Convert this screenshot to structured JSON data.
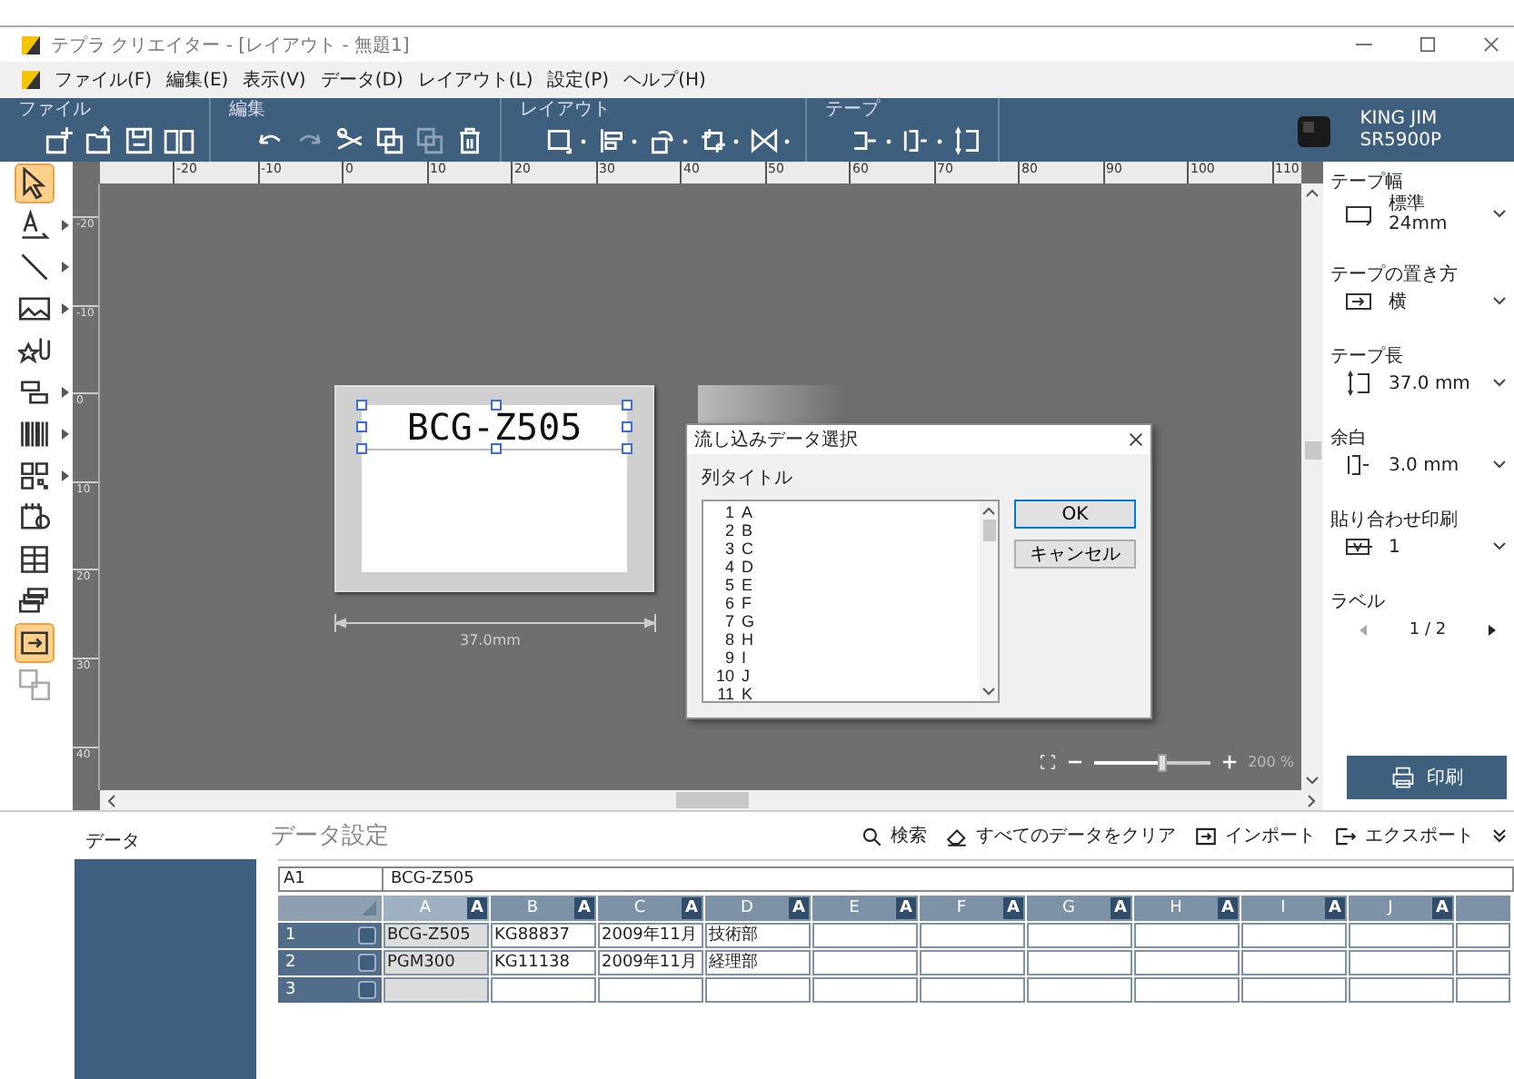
{
  "window": {
    "title": "テプラ クリエイター - [レイアウト - 無題1]"
  },
  "menu": [
    "ファイル(F)",
    "編集(E)",
    "表示(V)",
    "データ(D)",
    "レイアウト(L)",
    "設定(P)",
    "ヘルプ(H)"
  ],
  "ribbon": {
    "groups": [
      {
        "label": "ファイル",
        "tools": [
          {
            "kind": "new",
            "disabled": false,
            "dropdown": false
          },
          {
            "kind": "open",
            "disabled": false,
            "dropdown": false
          },
          {
            "kind": "save",
            "disabled": false,
            "dropdown": false
          },
          {
            "kind": "book",
            "disabled": false,
            "dropdown": false
          }
        ]
      },
      {
        "label": "編集",
        "tools": [
          {
            "kind": "undo",
            "disabled": false,
            "dropdown": false
          },
          {
            "kind": "redo",
            "disabled": true,
            "dropdown": false
          },
          {
            "kind": "cut",
            "disabled": false,
            "dropdown": false
          },
          {
            "kind": "copy",
            "disabled": false,
            "dropdown": false
          },
          {
            "kind": "paste",
            "disabled": true,
            "dropdown": false
          },
          {
            "kind": "trash",
            "disabled": false,
            "dropdown": false
          }
        ]
      },
      {
        "label": "レイアウト",
        "tools": [
          {
            "kind": "frame",
            "disabled": false,
            "dropdown": true
          },
          {
            "kind": "align",
            "disabled": false,
            "dropdown": true
          },
          {
            "kind": "rotate",
            "disabled": false,
            "dropdown": true
          },
          {
            "kind": "group",
            "disabled": false,
            "dropdown": true
          },
          {
            "kind": "bow",
            "disabled": false,
            "dropdown": true
          }
        ]
      },
      {
        "label": "テープ",
        "tools": [
          {
            "kind": "tape",
            "disabled": false,
            "dropdown": true
          },
          {
            "kind": "margin",
            "disabled": false,
            "dropdown": true
          },
          {
            "kind": "length",
            "disabled": false,
            "dropdown": false
          }
        ]
      }
    ],
    "printer": {
      "brand": "KING JIM",
      "model": "SR5900P"
    }
  },
  "tools": [
    {
      "kind": "pointer",
      "selected": true,
      "disabled": false,
      "submenu": false
    },
    {
      "kind": "text",
      "selected": false,
      "disabled": false,
      "submenu": true
    },
    {
      "kind": "line",
      "selected": false,
      "disabled": false,
      "submenu": true
    },
    {
      "kind": "image",
      "selected": false,
      "disabled": false,
      "submenu": true
    },
    {
      "kind": "clip",
      "selected": false,
      "disabled": false,
      "submenu": false
    },
    {
      "kind": "frames",
      "selected": false,
      "disabled": false,
      "submenu": true
    },
    {
      "kind": "barcode",
      "selected": false,
      "disabled": false,
      "submenu": true
    },
    {
      "kind": "qr",
      "selected": false,
      "disabled": false,
      "submenu": true
    },
    {
      "kind": "calendar",
      "selected": false,
      "disabled": false,
      "submenu": false
    },
    {
      "kind": "table",
      "selected": false,
      "disabled": false,
      "submenu": false
    },
    {
      "kind": "stack",
      "selected": false,
      "disabled": false,
      "submenu": false
    },
    {
      "kind": "import",
      "selected": true,
      "disabled": false,
      "submenu": false
    },
    {
      "kind": "translate",
      "selected": false,
      "disabled": true,
      "submenu": false
    }
  ],
  "ruler": {
    "horizontal": [
      "-20",
      "-10",
      "0",
      "10",
      "20",
      "30",
      "40",
      "50",
      "60",
      "70",
      "80",
      "90",
      "100",
      "110"
    ],
    "vertical": [
      "-20",
      "-10",
      "0",
      "10",
      "20",
      "30",
      "40"
    ]
  },
  "label": {
    "text": "BCG-Z505",
    "width": "37.0mm"
  },
  "dialog": {
    "title": "流し込みデータ選択",
    "heading": "列タイトル",
    "items": [
      {
        "num": "1",
        "name": "A"
      },
      {
        "num": "2",
        "name": "B"
      },
      {
        "num": "3",
        "name": "C"
      },
      {
        "num": "4",
        "name": "D"
      },
      {
        "num": "5",
        "name": "E"
      },
      {
        "num": "6",
        "name": "F"
      },
      {
        "num": "7",
        "name": "G"
      },
      {
        "num": "8",
        "name": "H"
      },
      {
        "num": "9",
        "name": "I"
      },
      {
        "num": "10",
        "name": "J"
      },
      {
        "num": "11",
        "name": "K"
      }
    ],
    "buttons": [
      {
        "label": "OK",
        "default": true
      },
      {
        "label": "キャンセル",
        "default": false
      }
    ]
  },
  "zoom": {
    "level": 0.6,
    "reading": "200 %"
  },
  "properties": [
    {
      "label": "テープ幅",
      "kind": "tape-width",
      "value": "標準",
      "sub": "24mm"
    },
    {
      "label": "テープの置き方",
      "kind": "direction",
      "value": "横"
    },
    {
      "label": "テープ長",
      "kind": "length",
      "value": "37.0 mm"
    },
    {
      "label": "余白",
      "kind": "margin",
      "value": "3.0 mm"
    },
    {
      "label": "貼り合わせ印刷",
      "kind": "tile",
      "value": "1"
    }
  ],
  "label_nav": {
    "title": "ラベル",
    "page": "1 / 2",
    "prev_disabled": true,
    "next_disabled": false
  },
  "print_button": "印刷",
  "data_panel": {
    "sidebar_title": "データ",
    "title": "データ設定",
    "actions": [
      {
        "kind": "search",
        "label": "検索"
      },
      {
        "kind": "eraser",
        "label": "すべてのデータをクリア"
      },
      {
        "kind": "import",
        "label": "インポート"
      },
      {
        "kind": "export",
        "label": "エクスポート"
      }
    ],
    "cell_ref": "A1",
    "cell_value": "BCG-Z505",
    "columns": [
      {
        "name": "A",
        "badge": "A",
        "selected": true
      },
      {
        "name": "B",
        "badge": "A",
        "selected": false
      },
      {
        "name": "C",
        "badge": "A",
        "selected": false
      },
      {
        "name": "D",
        "badge": "A",
        "selected": false
      },
      {
        "name": "E",
        "badge": "A",
        "selected": false
      },
      {
        "name": "F",
        "badge": "A",
        "selected": false
      },
      {
        "name": "G",
        "badge": "A",
        "selected": false
      },
      {
        "name": "H",
        "badge": "A",
        "selected": false
      },
      {
        "name": "I",
        "badge": "A",
        "selected": false
      },
      {
        "name": "J",
        "badge": "A",
        "selected": false
      }
    ],
    "rows": [
      {
        "num": "1",
        "checked": false,
        "cells": [
          "BCG-Z505",
          "KG88837",
          "2009年11月",
          "技術部"
        ]
      },
      {
        "num": "2",
        "checked": false,
        "cells": [
          "PGM300",
          "KG11138",
          "2009年11月",
          "経理部"
        ]
      },
      {
        "num": "3",
        "checked": false,
        "cells": []
      }
    ]
  }
}
